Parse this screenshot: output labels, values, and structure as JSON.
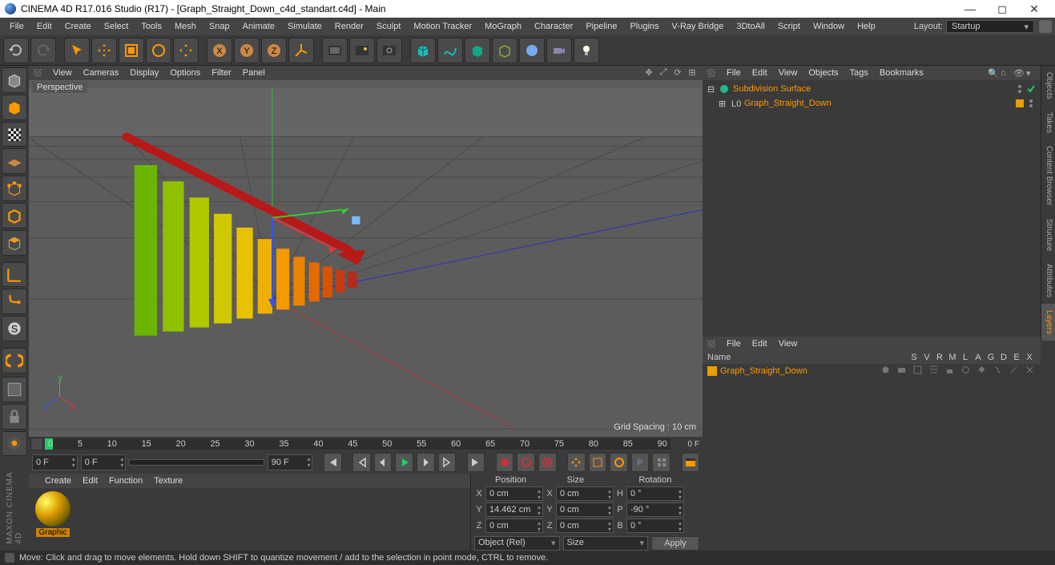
{
  "title": "CINEMA 4D R17.016 Studio (R17) - [Graph_Straight_Down_c4d_standart.c4d] - Main",
  "menu": [
    "File",
    "Edit",
    "Create",
    "Select",
    "Tools",
    "Mesh",
    "Snap",
    "Animate",
    "Simulate",
    "Render",
    "Sculpt",
    "Motion Tracker",
    "MoGraph",
    "Character",
    "Pipeline",
    "Plugins",
    "V-Ray Bridge",
    "3DtoAll",
    "Script",
    "Window",
    "Help"
  ],
  "layout": {
    "label": "Layout:",
    "value": "Startup"
  },
  "viewport": {
    "menus": [
      "View",
      "Cameras",
      "Display",
      "Options",
      "Filter",
      "Panel"
    ],
    "name": "Perspective",
    "grid_spacing": "Grid Spacing : 10 cm"
  },
  "timeline": {
    "start": "0",
    "end": "90",
    "ticks": [
      "0",
      "5",
      "10",
      "15",
      "20",
      "25",
      "30",
      "35",
      "40",
      "45",
      "50",
      "55",
      "60",
      "65",
      "70",
      "75",
      "80",
      "85",
      "90"
    ],
    "end_label": "0 F",
    "fields": {
      "cur": "0 F",
      "from": "0 F",
      "to": "90 F"
    }
  },
  "materials": {
    "menus": [
      "Create",
      "Edit",
      "Function",
      "Texture"
    ],
    "mat_name": "Graphic"
  },
  "coord": {
    "headers": [
      "Position",
      "Size",
      "Rotation"
    ],
    "rows": [
      {
        "a": "X",
        "pv": "0 cm",
        "sl": "X",
        "sv": "0 cm",
        "rl": "H",
        "rv": "0 °"
      },
      {
        "a": "Y",
        "pv": "14.462 cm",
        "sl": "Y",
        "sv": "0 cm",
        "rl": "P",
        "rv": "-90 °"
      },
      {
        "a": "Z",
        "pv": "0 cm",
        "sl": "Z",
        "sv": "0 cm",
        "rl": "B",
        "rv": "0 °"
      }
    ],
    "sel1": "Object (Rel)",
    "sel2": "Size",
    "apply": "Apply"
  },
  "objects": {
    "menus": [
      "File",
      "Edit",
      "View",
      "Objects",
      "Tags",
      "Bookmarks"
    ],
    "tree": [
      {
        "name": "Subdivision Surface",
        "indent": 0,
        "exp": "⊟",
        "icon": "subdiv",
        "sel": false
      },
      {
        "name": "Graph_Straight_Down",
        "indent": 1,
        "exp": "⊞",
        "icon": "null",
        "sel": false
      }
    ]
  },
  "layers": {
    "menus": [
      "File",
      "Edit",
      "View"
    ],
    "headers": {
      "name": "Name",
      "cols": [
        "S",
        "V",
        "R",
        "M",
        "L",
        "A",
        "G",
        "D",
        "E",
        "X"
      ]
    },
    "rows": [
      {
        "name": "Graph_Straight_Down"
      }
    ]
  },
  "right_tabs": [
    "Objects",
    "Takes",
    "Content Browser",
    "Structure",
    "Attributes",
    "Layers"
  ],
  "status": "Move: Click and drag to move elements. Hold down SHIFT to quantize movement / add to the selection in point mode, CTRL to remove."
}
